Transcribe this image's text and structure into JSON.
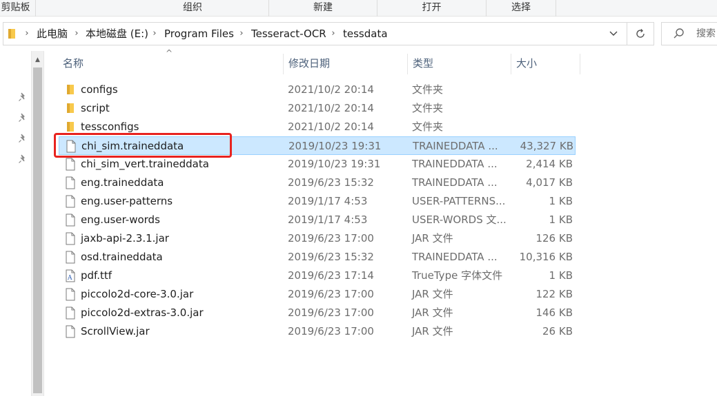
{
  "ribbon": {
    "sections": [
      "剪贴板",
      "组织",
      "新建",
      "打开",
      "选择"
    ]
  },
  "address": {
    "crumbs": [
      "此电脑",
      "本地磁盘 (E:)",
      "Program Files",
      "Tesseract-OCR",
      "tessdata"
    ],
    "search_placeholder": "搜索"
  },
  "columns": {
    "name": "名称",
    "date": "修改日期",
    "type": "类型",
    "size": "大小"
  },
  "files": [
    {
      "name": "configs",
      "date": "2021/10/2 20:14",
      "type": "文件夹",
      "size": "",
      "icon": "folder-icon"
    },
    {
      "name": "script",
      "date": "2021/10/2 20:14",
      "type": "文件夹",
      "size": "",
      "icon": "folder-icon"
    },
    {
      "name": "tessconfigs",
      "date": "2021/10/2 20:14",
      "type": "文件夹",
      "size": "",
      "icon": "folder-icon"
    },
    {
      "name": "chi_sim.traineddata",
      "date": "2019/10/23 19:31",
      "type": "TRAINEDDATA ...",
      "size": "43,327 KB",
      "icon": "file-icon",
      "selected": true
    },
    {
      "name": "chi_sim_vert.traineddata",
      "date": "2019/10/23 19:31",
      "type": "TRAINEDDATA ...",
      "size": "2,414 KB",
      "icon": "file-icon"
    },
    {
      "name": "eng.traineddata",
      "date": "2019/6/23 15:32",
      "type": "TRAINEDDATA ...",
      "size": "4,017 KB",
      "icon": "file-icon"
    },
    {
      "name": "eng.user-patterns",
      "date": "2019/1/17 4:53",
      "type": "USER-PATTERNS...",
      "size": "1 KB",
      "icon": "file-icon"
    },
    {
      "name": "eng.user-words",
      "date": "2019/1/17 4:53",
      "type": "USER-WORDS 文...",
      "size": "1 KB",
      "icon": "file-icon"
    },
    {
      "name": "jaxb-api-2.3.1.jar",
      "date": "2019/6/23 17:00",
      "type": "JAR 文件",
      "size": "126 KB",
      "icon": "file-icon"
    },
    {
      "name": "osd.traineddata",
      "date": "2019/6/23 15:32",
      "type": "TRAINEDDATA ...",
      "size": "10,316 KB",
      "icon": "file-icon"
    },
    {
      "name": "pdf.ttf",
      "date": "2019/6/23 17:14",
      "type": "TrueType 字体文件",
      "size": "1 KB",
      "icon": "font-file-icon"
    },
    {
      "name": "piccolo2d-core-3.0.jar",
      "date": "2019/6/23 17:00",
      "type": "JAR 文件",
      "size": "122 KB",
      "icon": "file-icon"
    },
    {
      "name": "piccolo2d-extras-3.0.jar",
      "date": "2019/6/23 17:00",
      "type": "JAR 文件",
      "size": "146 KB",
      "icon": "file-icon"
    },
    {
      "name": "ScrollView.jar",
      "date": "2019/6/23 17:00",
      "type": "JAR 文件",
      "size": "26 KB",
      "icon": "file-icon"
    }
  ],
  "colors": {
    "selection_bg": "#cce8ff",
    "highlight_border": "#e8231f",
    "folder_yellow": "#f8c94c"
  }
}
